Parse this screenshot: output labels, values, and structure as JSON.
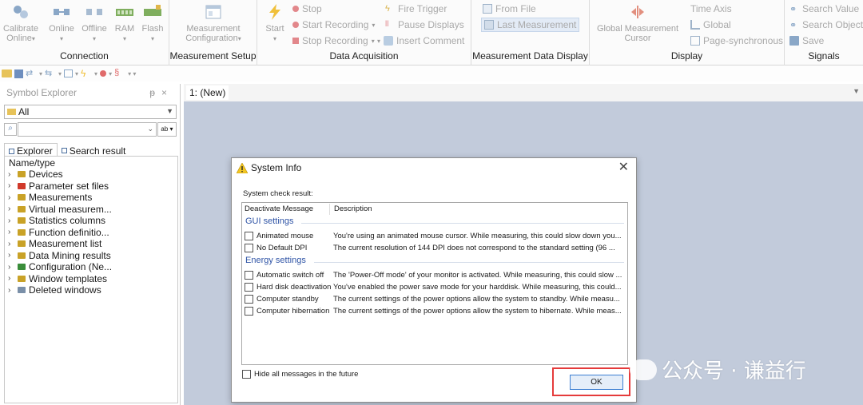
{
  "ribbon": {
    "connection": {
      "label": "Connection",
      "calibrate_online": "Calibrate\nOnline",
      "online": "Online",
      "offline": "Offline",
      "ram": "RAM",
      "flash": "Flash"
    },
    "measurement_setup": {
      "label": "Measurement Setup",
      "configuration": "Measurement\nConfiguration"
    },
    "data_acquisition": {
      "label": "Data Acquisition",
      "start": "Start",
      "stop": "Stop",
      "start_recording": "Start Recording",
      "stop_recording": "Stop Recording",
      "fire_trigger": "Fire Trigger",
      "pause_displays": "Pause Displays",
      "insert_comment": "Insert Comment"
    },
    "measurement_data_display": {
      "label": "Measurement Data Display",
      "from_file": "From File",
      "last_measurement": "Last Measurement"
    },
    "display": {
      "label": "Display",
      "global_cursor": "Global Measurement\nCursor",
      "time_axis": "Time Axis",
      "global": "Global",
      "page_synchronous": "Page-synchronous"
    },
    "signals": {
      "label": "Signals",
      "search_value": "Search Value",
      "search_object": "Search Object",
      "save": "Save"
    }
  },
  "explorer": {
    "title": "Symbol Explorer",
    "filter_value": "All",
    "search_value": "",
    "tabs": [
      "Explorer",
      "Search result"
    ],
    "column_header": "Name/type",
    "items": [
      {
        "label": "Devices",
        "color": "#c9a227"
      },
      {
        "label": "Parameter set files",
        "color": "#d0392b"
      },
      {
        "label": "Measurements",
        "color": "#c9a227"
      },
      {
        "label": "Virtual measurem...",
        "color": "#c9a227"
      },
      {
        "label": "Statistics columns",
        "color": "#c9a227"
      },
      {
        "label": "Function definitio...",
        "color": "#c9a227"
      },
      {
        "label": "Measurement list",
        "color": "#c9a227"
      },
      {
        "label": "Data Mining results",
        "color": "#c9a227"
      },
      {
        "label": "Configuration (Ne...",
        "color": "#3a8d3a"
      },
      {
        "label": "Window templates",
        "color": "#c9a227"
      },
      {
        "label": "Deleted windows",
        "color": "#7a8fa8"
      }
    ]
  },
  "main": {
    "tab_label": "1: (New)"
  },
  "dialog": {
    "title": "System Info",
    "check_result_label": "System check result:",
    "columns": [
      "Deactivate Message",
      "Description"
    ],
    "sections": [
      {
        "title": "GUI settings",
        "rows": [
          {
            "name": "Animated mouse",
            "description": "You're using an animated mouse cursor. While measuring, this could slow down you..."
          },
          {
            "name": "No Default DPI",
            "description": "The current resolution of 144 DPI does not correspond to the standard setting (96 ..."
          }
        ]
      },
      {
        "title": "Energy settings",
        "rows": [
          {
            "name": "Automatic switch off",
            "description": "The 'Power-Off mode' of your monitor is activated. While measuring, this could slow ..."
          },
          {
            "name": "Hard disk deactivation",
            "description": "You've enabled the power save mode for your harddisk. While measuring, this could..."
          },
          {
            "name": "Computer standby",
            "description": "The current settings of the power options allow the system to standby. While measu..."
          },
          {
            "name": "Computer hibernation",
            "description": "The current settings of the power options allow the system to hibernate. While meas..."
          }
        ]
      }
    ],
    "hide_label": "Hide all messages in the future",
    "ok_label": "OK"
  },
  "watermark": {
    "text": "公众号 · 谦益行"
  },
  "colors": {
    "main_bg": "#c2cbdb",
    "section_title": "#2f54a6",
    "highlight": "#e53b3b",
    "ok_border": "#3c7fd2"
  }
}
